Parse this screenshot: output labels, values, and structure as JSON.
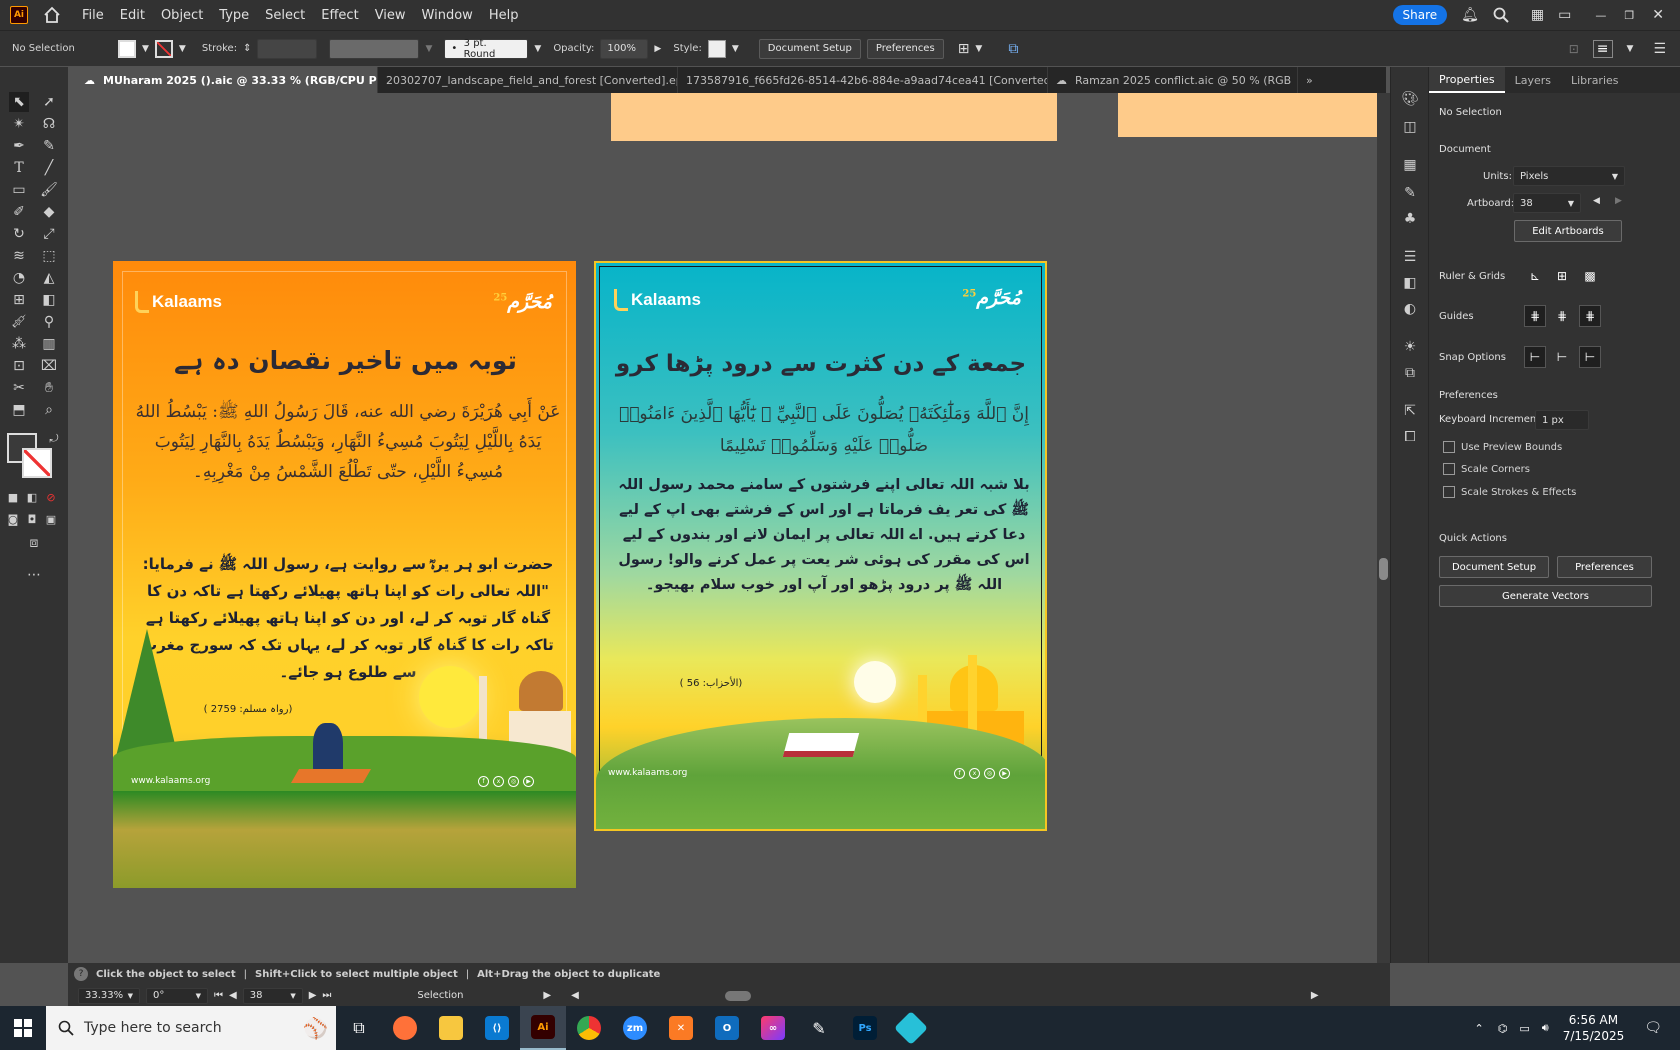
{
  "app": {
    "logo": "Ai",
    "home_icon": "home-icon"
  },
  "menu": [
    "File",
    "Edit",
    "Object",
    "Type",
    "Select",
    "Effect",
    "View",
    "Window",
    "Help"
  ],
  "share_label": "Share",
  "control": {
    "selection": "No Selection",
    "stroke_label": "Stroke:",
    "brush": "3 pt. Round",
    "opacity_label": "Opacity:",
    "opacity": "100%",
    "style_label": "Style:",
    "doc_setup": "Document Setup",
    "preferences": "Preferences"
  },
  "tabs": [
    {
      "label": "MUharam 2025 ().aic @ 33.33 % (RGB/CPU Preview)",
      "active": true
    },
    {
      "label": "20302707_landscape_field_and_forest [Converted].eps*"
    },
    {
      "label": "173587916_f665fd26-8514-42b6-884e-a9aad74cea41 [Converted].eps*"
    },
    {
      "label": "Ramzan 2025 conflict.aic @ 50 % (RGB"
    }
  ],
  "properties": {
    "tabs": [
      "Properties",
      "Layers",
      "Libraries"
    ],
    "no_selection": "No Selection",
    "document": "Document",
    "units_label": "Units:",
    "units": "Pixels",
    "artboard_label": "Artboard:",
    "artboard": "38",
    "edit_artboards": "Edit Artboards",
    "ruler_grids": "Ruler & Grids",
    "guides": "Guides",
    "snap_options": "Snap Options",
    "preferences": "Preferences",
    "keyboard_increment_label": "Keyboard Increment:",
    "keyboard_increment": "1 px",
    "use_preview_bounds": "Use Preview Bounds",
    "scale_corners": "Scale Corners",
    "scale_strokes": "Scale Strokes & Effects",
    "quick_actions": "Quick Actions",
    "qa_doc_setup": "Document Setup",
    "qa_preferences": "Preferences",
    "generate_vectors": "Generate Vectors"
  },
  "status": {
    "hint1": "Click the object to select",
    "hint2": "Shift+Click to select multiple object",
    "hint3": "Alt+Drag the object to duplicate",
    "zoom": "33.33%",
    "rotation": "0°",
    "artboard": "38",
    "mode": "Selection"
  },
  "artboard1": {
    "brand": "Kalaams",
    "badge": "مُحَرَّم",
    "badge_num": "25",
    "heading": "توبہ میں تاخیر نقصان دہ ہے",
    "arabic": "عَنْ أَبِي هُرَيْرَةَ رضي الله عنه، قَالَ رَسُولُ اللهِ ﷺ: يَبْسُطُ اللهُ يَدَهُ بِاللَّيْلِ لِيَتُوبَ مُسِيءُ النَّهَارِ، وَيَبْسُطُ يَدَهُ بِالنَّهَارِ لِيَتُوبَ مُسِيءُ اللَّيْلِ، حتّى تَطْلُعَ الشَّمْسُ مِنْ مَغْرِبِهِ۔",
    "urdu": "حضرت ابو ہر یرہؓ سے روایت ہے، رسول اللہ ﷺ نے فرمایا: \"اللہ تعالی رات کو اپنا ہاتھ پھیلائے رکھتا ہے تاکہ دن کا گناہ گار توبہ کر لے، اور دن کو اپنا ہاتھ پھیلائے رکھتا ہے تاکہ رات کا گناہ گار توبہ کر لے، یہاں تک کہ سورج مغرب سے طلوع ہو جائے۔",
    "ref": "(رواہ مسلم: 2759 )",
    "url": "www.kalaams.org"
  },
  "artboard2": {
    "brand": "Kalaams",
    "badge": "مُحَرَّم",
    "badge_num": "25",
    "heading": "جمعة کے دن کثرت سے درود پڑھا کرو",
    "arabic": "إِنَّ ٱللَّهَ وَمَلَٰٓئِكَتَهُۥ يُصَلُّونَ عَلَى ٱلنَّبِيِّ ۚ يَٰٓأَيُّهَا ٱلَّذِينَ ءَامَنُوا۟ صَلُّوا۟ عَلَيْهِ وَسَلِّمُوا۟ تَسْلِيمًا",
    "urdu": "بلا شبہ اللہ تعالی اپنے فرشتوں کے سامنے محمد رسول اللہ ﷺ کی تعر یف فرماتا ہے اور اس کے فرشتے بھی اپ کے لیے دعا کرتے ہیں. اے اللہ تعالی پر ایمان لانے اور بندوں کے لیے اس کی مقرر کی ہوئی شر یعت پر عمل کرنے والو! رسول اللہ ﷺ پر درود پڑھو اور آپ اور خوب سلام بھیجو۔",
    "ref": "(الأحزاب: 56 )",
    "url": "www.kalaams.org"
  },
  "taskbar": {
    "search_placeholder": "Type here to search",
    "time": "6:56 AM",
    "date": "7/15/2025"
  }
}
